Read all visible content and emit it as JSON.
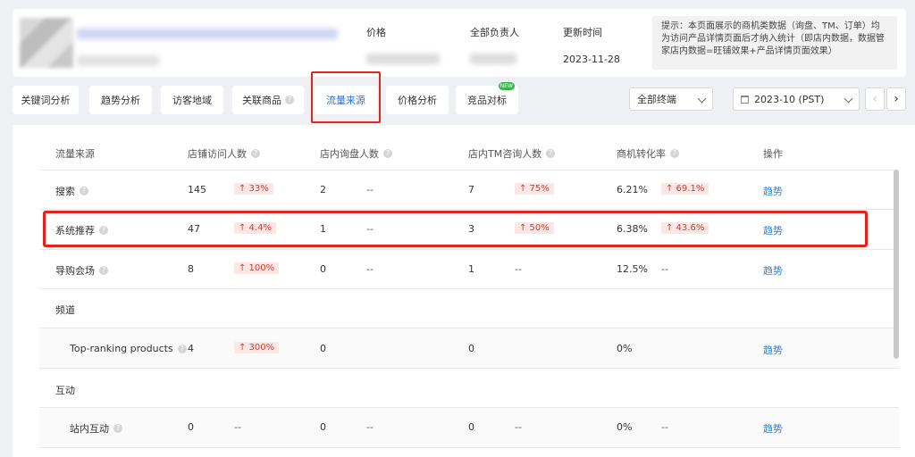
{
  "header": {
    "price_label": "价格",
    "owner_label": "全部负责人",
    "updated_label": "更新时间",
    "updated_value": "2023-11-28",
    "tip": "提示：本页面展示的商机类数据（询盘、TM、订单）均为访问产品详情页面后才纳入统计（即店内数据，数据管家店内数据=旺铺效果+产品详情页面效果）"
  },
  "tabs": [
    {
      "label": "关键词分析"
    },
    {
      "label": "趋势分析"
    },
    {
      "label": "访客地域"
    },
    {
      "label": "关联商品"
    },
    {
      "label": "流量来源"
    },
    {
      "label": "价格分析"
    },
    {
      "label": "竞品对标",
      "badge": "NEW"
    }
  ],
  "filters": {
    "terminal": "全部终端",
    "month": "2023-10 (PST)"
  },
  "table": {
    "columns": [
      "流量来源",
      "店铺访问人数",
      "店内询盘人数",
      "店内TM咨询人数",
      "商机转化率",
      "操作"
    ],
    "rows": [
      {
        "name": "搜索",
        "visitors": "145",
        "visitors_chg": "↑ 33%",
        "inquiry": "2",
        "inquiry_chg": "--",
        "tm": "7",
        "tm_chg": "↑ 75%",
        "rate": "6.21%",
        "rate_chg": "↑ 69.1%",
        "action": "趋势"
      },
      {
        "name": "系统推荐",
        "visitors": "47",
        "visitors_chg": "↑ 4.4%",
        "inquiry": "1",
        "inquiry_chg": "--",
        "tm": "3",
        "tm_chg": "↑ 50%",
        "rate": "6.38%",
        "rate_chg": "↑ 43.6%",
        "action": "趋势"
      },
      {
        "name": "导购会场",
        "visitors": "8",
        "visitors_chg": "↑ 100%",
        "inquiry": "0",
        "inquiry_chg": "--",
        "tm": "1",
        "tm_chg": "--",
        "rate": "12.5%",
        "rate_chg": "--",
        "action": "趋势"
      },
      {
        "name": "频道"
      },
      {
        "name": "Top-ranking products",
        "visitors": "4",
        "visitors_chg": "↑ 300%",
        "inquiry": "0",
        "inquiry_chg": "",
        "tm": "0",
        "tm_chg": "",
        "rate": "0%",
        "rate_chg": "",
        "action": "趋势"
      },
      {
        "name": "互动"
      },
      {
        "name": "站内互动",
        "visitors": "0",
        "visitors_chg": "--",
        "inquiry": "0",
        "inquiry_chg": "--",
        "tm": "0",
        "tm_chg": "--",
        "rate": "0%",
        "rate_chg": "--",
        "action": "趋势"
      }
    ]
  }
}
